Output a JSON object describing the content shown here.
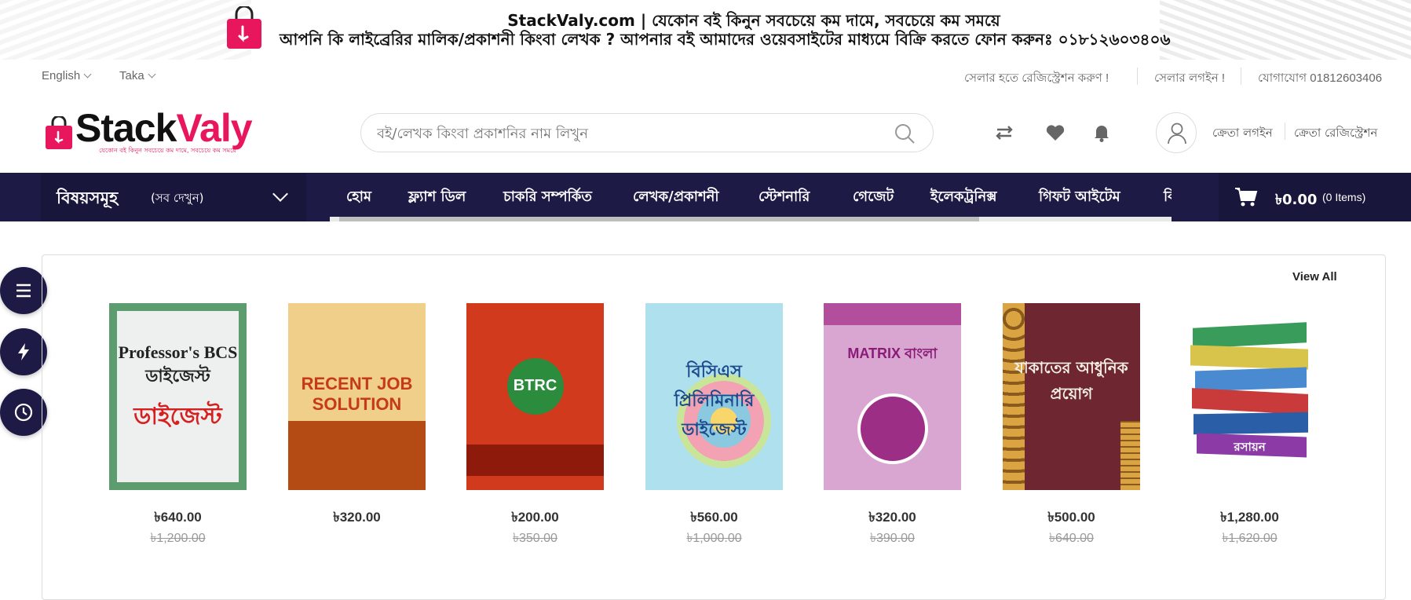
{
  "banner": {
    "line1": "StackValy.com | যেকোন বই কিনুন সবচেয়ে কম দামে, সবচেয়ে কম সময়ে",
    "line2": "আপনি কি লাইব্রেরির মালিক/প্রকাশনী কিংবা লেখক ? আপনার বই আমাদের ওয়েবসাইটের মাধ্যমে বিক্রি করতে ফোন করুনঃ ০১৮১২৬০৩৪০৬"
  },
  "topbar": {
    "language": "English",
    "currency": "Taka",
    "seller_register": "সেলার হতে রেজিস্ট্রেশন করুণ !",
    "seller_login": "সেলার লগইন !",
    "contact": "যোগাযোগ 01812603406"
  },
  "header": {
    "logo_stack": "Stack",
    "logo_valy": "Valy",
    "logo_tagline": "যেকোন বই কিনুন সবচেয়ে কম দামে, সবচেয়ে কম সময়ে",
    "search_placeholder": "বই/লেখক কিংবা প্রকাশনির নাম লিখুন",
    "buyer_login": "ক্রেতা লগইন",
    "buyer_register": "ক্রেতা রেজিস্ট্রেশন"
  },
  "nav": {
    "categories_title": "বিষয়সমূহ",
    "categories_sub": "(সব দেখুন)",
    "items": [
      "হোম",
      "ফ্ল্যাশ ডিল",
      "চাকরি সম্পর্কিত",
      "লেখক/প্রকাশনী",
      "স্টেশনারি",
      "গেজেট",
      "ইলেকট্রনিক্স",
      "গিফট আইটেম",
      "কি"
    ],
    "cart_total": "৳0.00",
    "cart_items": "(0 Items)"
  },
  "section": {
    "view_all": "View All"
  },
  "products": [
    {
      "price": "৳640.00",
      "old_price": "৳1,200.00",
      "cover_text": "Professor's BCS ডাইজেস্ট",
      "cover_color": "#5d9c6e"
    },
    {
      "price": "৳320.00",
      "old_price": "",
      "cover_text": "RECENT JOB SOLUTION",
      "cover_color": "#c8541b"
    },
    {
      "price": "৳200.00",
      "old_price": "৳350.00",
      "cover_text": "BTRC",
      "cover_color": "#d23a1e"
    },
    {
      "price": "৳560.00",
      "old_price": "৳1,000.00",
      "cover_text": "বিসিএস প্রিলিমিনারি ডাইজেস্ট",
      "cover_color": "#aee0ee"
    },
    {
      "price": "৳320.00",
      "old_price": "৳390.00",
      "cover_text": "MATRIX বাংলা",
      "cover_color": "#c07bb6"
    },
    {
      "price": "৳500.00",
      "old_price": "৳640.00",
      "cover_text": "যাকাতের আধুনিক প্রয়োগ",
      "cover_color": "#6e2630"
    },
    {
      "price": "৳1,280.00",
      "old_price": "৳1,620.00",
      "cover_text": "রসায়ন",
      "cover_color": "#ffffff"
    }
  ],
  "colors": {
    "nav_bg": "#1e1a46",
    "brand_pink": "#e8175d"
  }
}
